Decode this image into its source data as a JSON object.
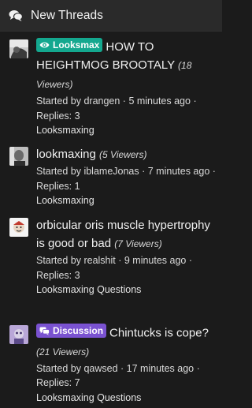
{
  "header": {
    "title": "New Threads",
    "icon": "comments-icon"
  },
  "threads": [
    {
      "label": "Looksmax",
      "label_icon": "eye-icon",
      "title": "HOW TO HEIGHTMOG BROOTALY",
      "viewers": "(18 Viewers)",
      "started_by_prefix": "Started by ",
      "author": "drangen",
      "time": "5 minutes ago",
      "replies": "Replies: 3",
      "forum": "Looksmaxing"
    },
    {
      "label": "",
      "title": "lookmaxing",
      "viewers": "(5 Viewers)",
      "started_by_prefix": "Started by ",
      "author": "iblameJonas",
      "time": "7 minutes ago",
      "replies": "Replies: 1",
      "forum": "Looksmaxing"
    },
    {
      "label": "",
      "title": "orbicular oris muscle hypertrophy is good or bad",
      "viewers": "(7 Viewers)",
      "started_by_prefix": "Started by ",
      "author": "realshit",
      "time": "9 minutes ago",
      "replies": "Replies: 3",
      "forum": "Looksmaxing Questions"
    },
    {
      "label": "Discussion",
      "label_icon": "chat-bubbles-icon",
      "title": "Chintucks is cope?",
      "viewers": "(21 Viewers)",
      "started_by_prefix": "Started by ",
      "author": "qawsed",
      "time": "17 minutes ago",
      "replies": "Replies: 7",
      "forum": "Looksmaxing Questions"
    }
  ],
  "colors": {
    "background": "#1b1b1b",
    "header": "#2a2a2a",
    "looksmax_label": "#14a88f",
    "discussion_label": "#7a52d1"
  }
}
